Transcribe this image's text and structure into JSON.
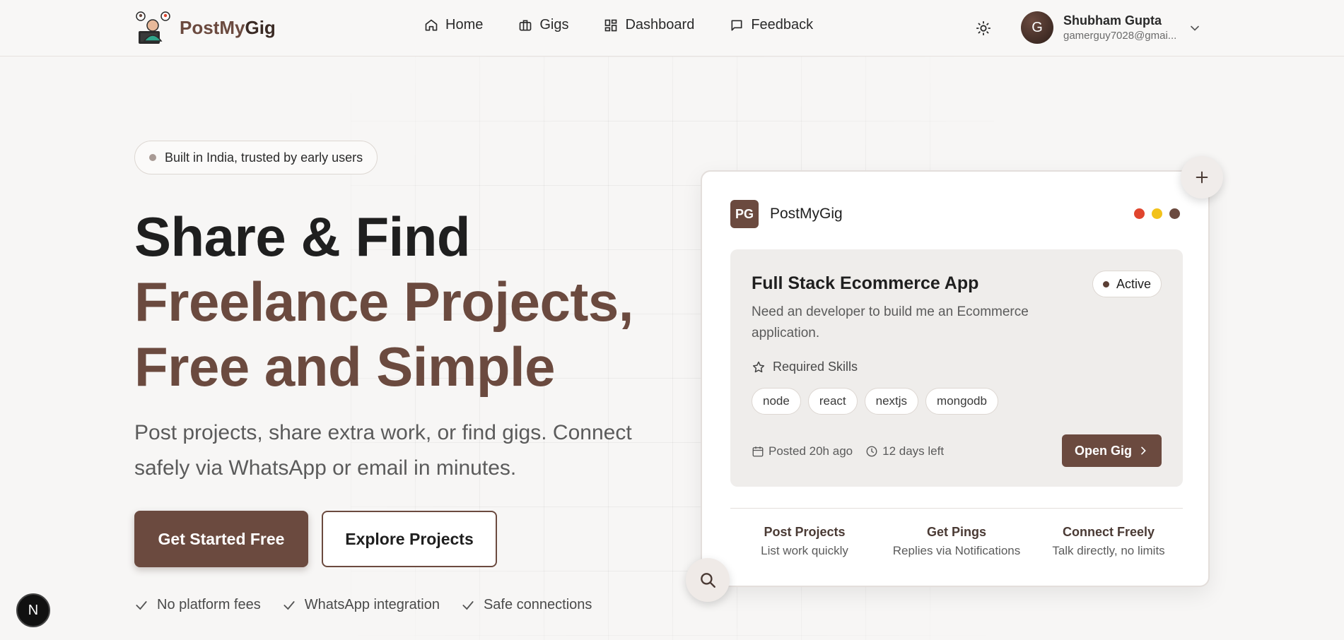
{
  "brand": {
    "name_part1": "PostMy",
    "name_part2": "Gig"
  },
  "nav": {
    "items": [
      {
        "label": "Home",
        "icon": "home-icon"
      },
      {
        "label": "Gigs",
        "icon": "briefcase-icon"
      },
      {
        "label": "Dashboard",
        "icon": "dashboard-icon"
      },
      {
        "label": "Feedback",
        "icon": "message-icon"
      }
    ]
  },
  "user": {
    "initial": "G",
    "name": "Shubham Gupta",
    "email": "gamerguy7028@gmai..."
  },
  "hero": {
    "badge": "Built in India, trusted by early users",
    "title_line1": "Share & Find",
    "title_line2": "Freelance Projects,",
    "title_line3": "Free and Simple",
    "subtitle": "Post projects, share extra work, or find gigs. Connect safely via WhatsApp or email in minutes.",
    "primary_cta": "Get Started Free",
    "secondary_cta": "Explore Projects",
    "features": [
      "No platform fees",
      "WhatsApp integration",
      "Safe connections"
    ]
  },
  "card": {
    "logo_initials": "PG",
    "app_name": "PostMyGig",
    "window_dot_colors": [
      "#e0452e",
      "#f2c21a",
      "#6b4a3f"
    ],
    "gig": {
      "title": "Full Stack Ecommerce App",
      "status": "Active",
      "description": "Need an developer to build me an Ecommerce application.",
      "skills_label": "Required Skills",
      "skills": [
        "node",
        "react",
        "nextjs",
        "mongodb"
      ],
      "posted": "Posted 20h ago",
      "deadline": "12 days left",
      "open_label": "Open Gig"
    },
    "stats": [
      {
        "title": "Post Projects",
        "desc": "List work quickly"
      },
      {
        "title": "Get Pings",
        "desc": "Replies via Notifications"
      },
      {
        "title": "Connect Freely",
        "desc": "Talk directly, no limits"
      }
    ]
  },
  "dev_badge": "N",
  "colors": {
    "brand": "#6b4a3f",
    "background": "#f7f6f5"
  }
}
